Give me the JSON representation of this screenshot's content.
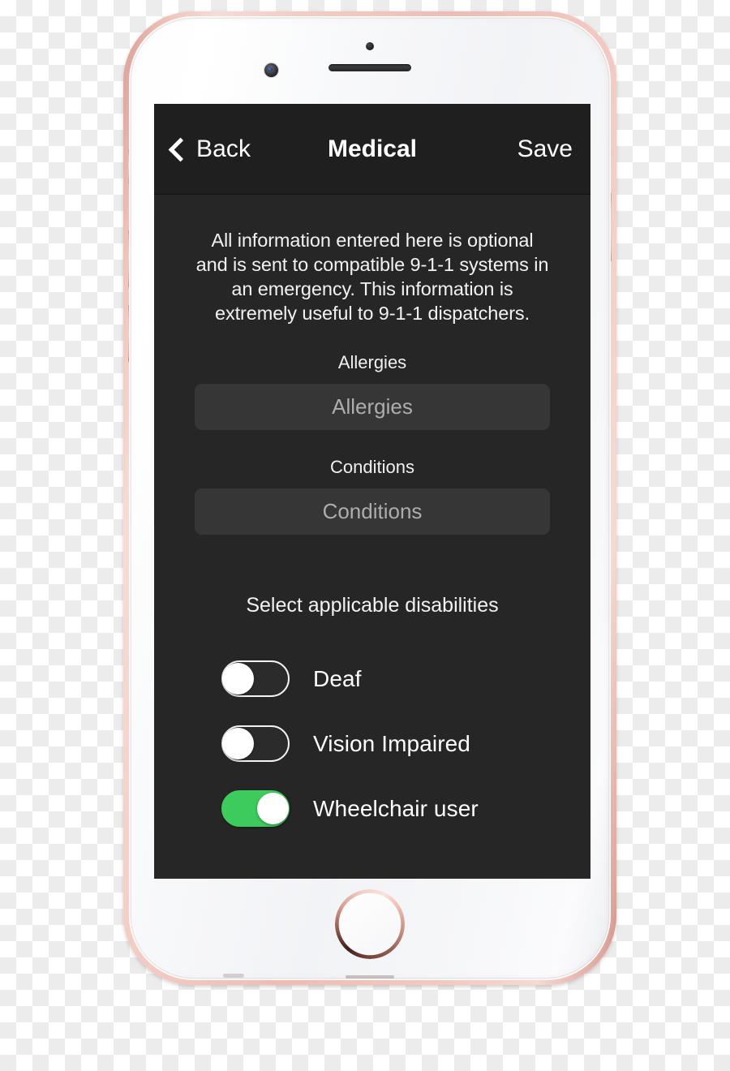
{
  "device": {
    "name": "smartphone-mockup",
    "frame_color": "#eebdb4",
    "face_color": "#f7f8fa"
  },
  "screen": {
    "background_color": "#262626",
    "navbar": {
      "background_color": "#1f1f1f",
      "back_label": "Back",
      "back_icon": "chevron-left-icon",
      "title": "Medical",
      "save_label": "Save"
    },
    "intro_text": "All information entered here is optional and is sent to compatible 9-1-1 systems in an emergency. This information is extremely useful to 9-1-1 dispatchers.",
    "fields": [
      {
        "label": "Allergies",
        "placeholder": "Allergies",
        "value": "",
        "name": "allergies"
      },
      {
        "label": "Conditions",
        "placeholder": "Conditions",
        "value": "",
        "name": "conditions"
      }
    ],
    "disabilities": {
      "section_title": "Select applicable disabilities",
      "on_color": "#3ecb5d",
      "off_color": "#2b2b2b",
      "items": [
        {
          "label": "Deaf",
          "state": "off"
        },
        {
          "label": "Vision Impaired",
          "state": "off"
        },
        {
          "label": "Wheelchair user",
          "state": "on"
        }
      ]
    }
  }
}
